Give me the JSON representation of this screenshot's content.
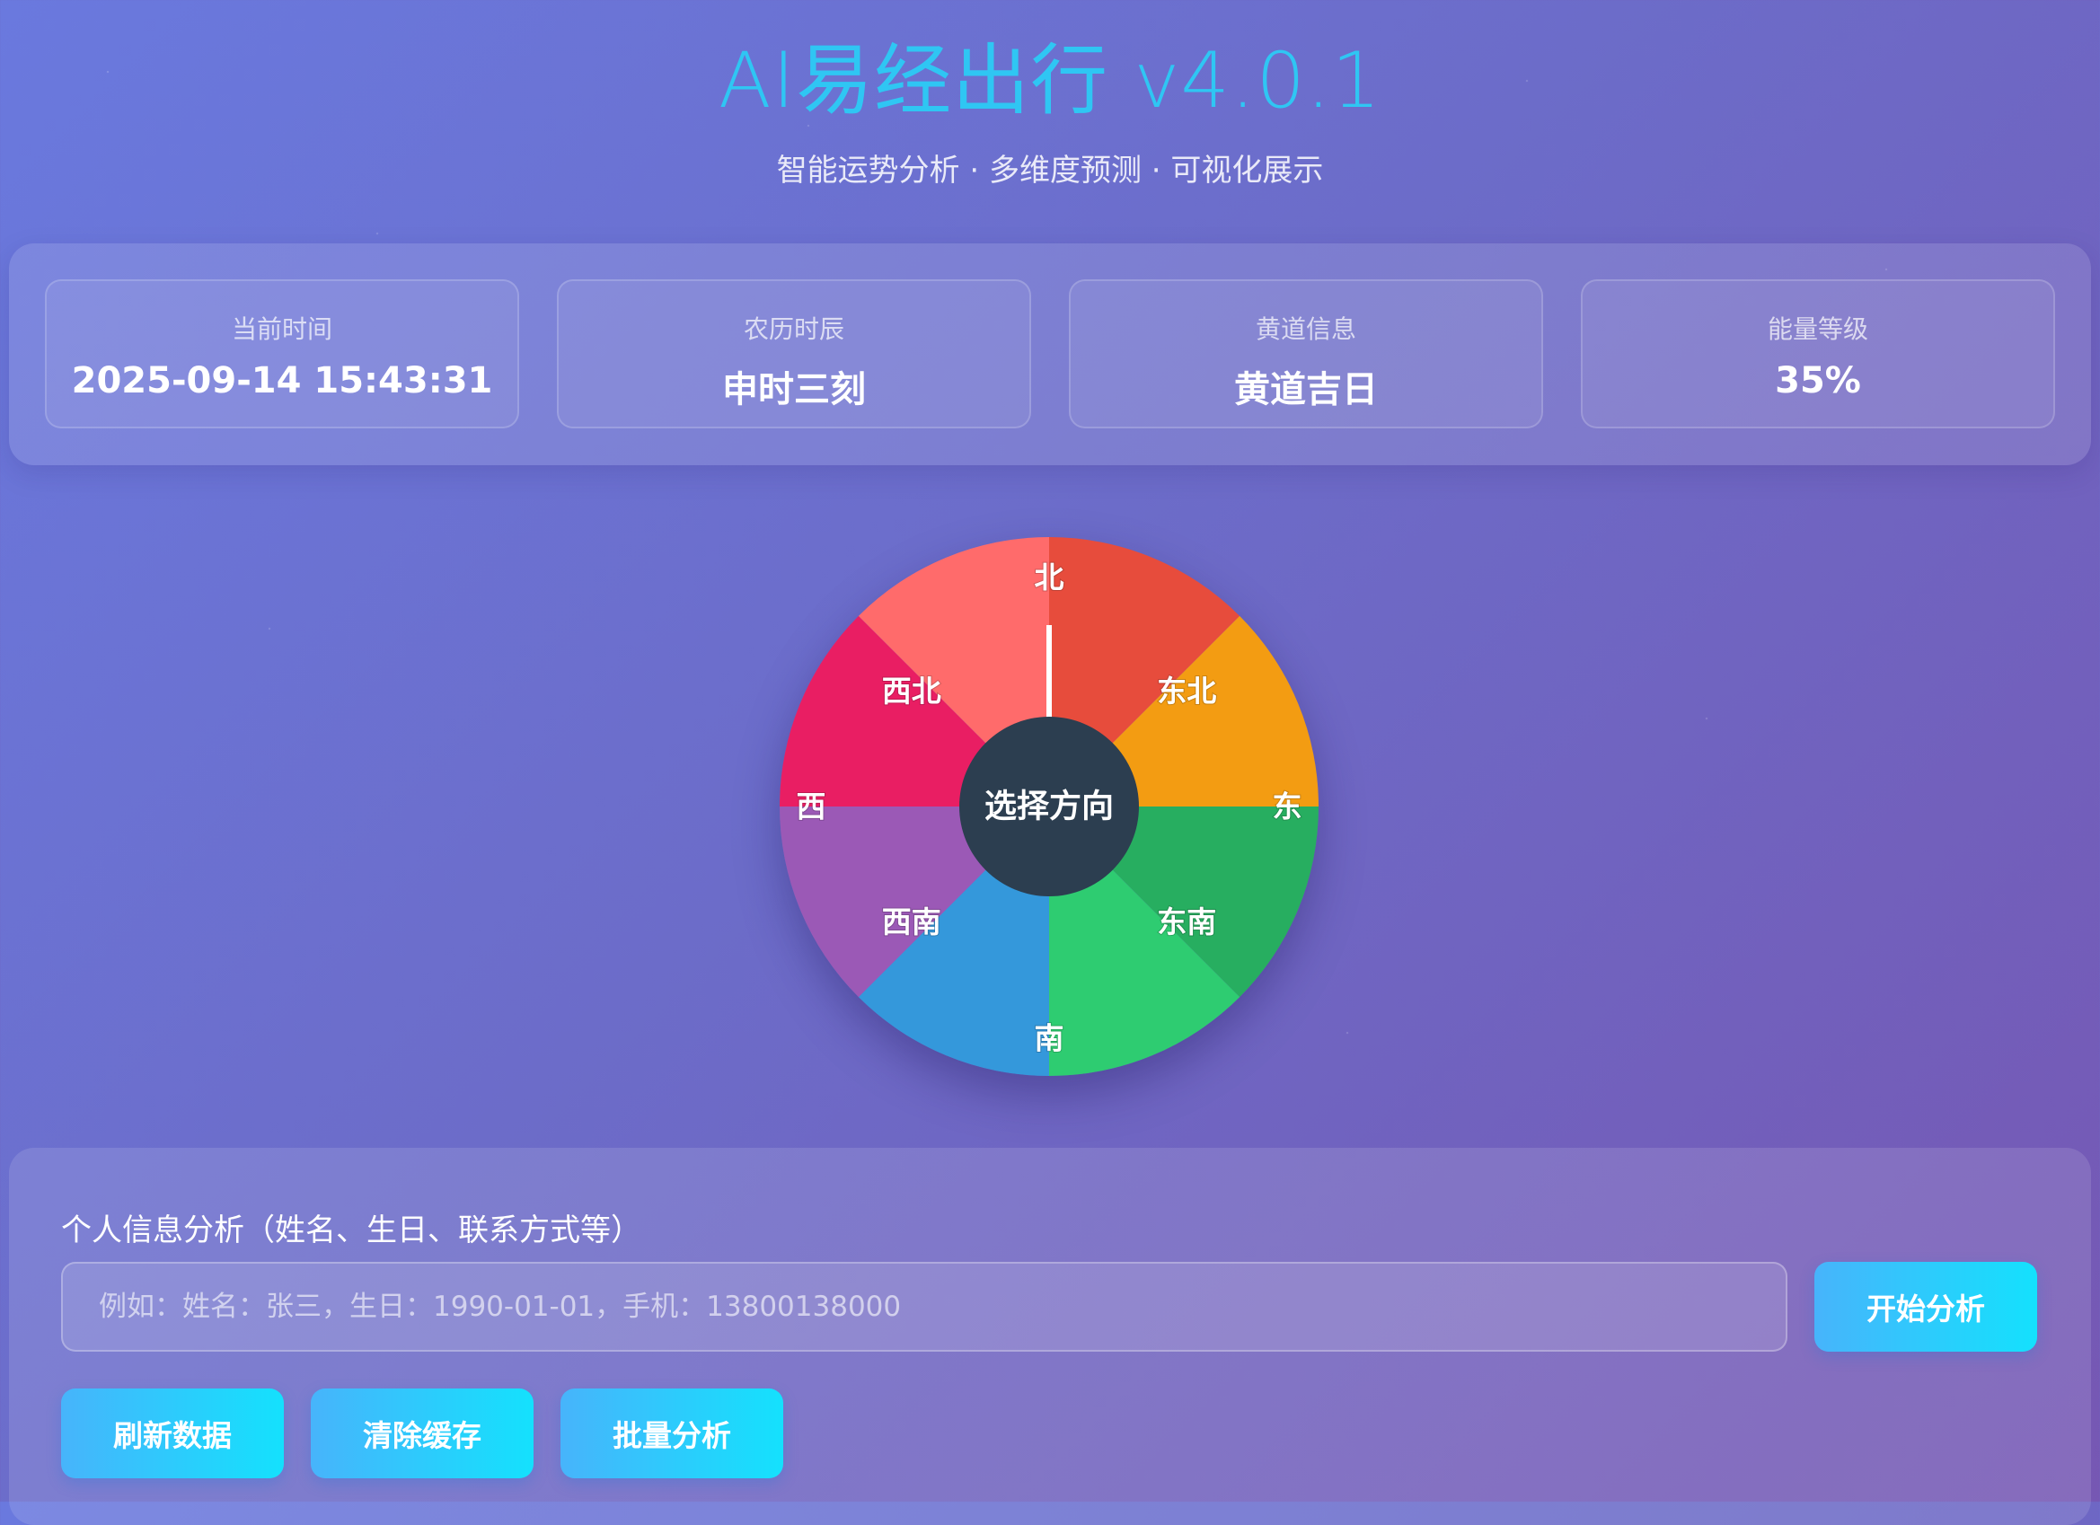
{
  "header": {
    "title": "AI易经出行 v4.0.1",
    "subtitle": "智能运势分析 · 多维度预测 · 可视化展示"
  },
  "info_cards": [
    {
      "label": "当前时间",
      "value": "2025-09-14 15:43:31"
    },
    {
      "label": "农历时辰",
      "value": "申时三刻"
    },
    {
      "label": "黄道信息",
      "value": "黄道吉日"
    },
    {
      "label": "能量等级",
      "value": "35%"
    }
  ],
  "wheel": {
    "center_label": "选择方向",
    "directions": [
      {
        "label": "北",
        "color": "#e74c3c"
      },
      {
        "label": "东北",
        "color": "#f39c12"
      },
      {
        "label": "东",
        "color": "#27ae60"
      },
      {
        "label": "东南",
        "color": "#2ecc71"
      },
      {
        "label": "南",
        "color": "#3498db"
      },
      {
        "label": "西南",
        "color": "#9b59b6"
      },
      {
        "label": "西",
        "color": "#e91e63"
      },
      {
        "label": "西北",
        "color": "#ff6b6b"
      }
    ],
    "center_color": "#2c3e50",
    "pointer_direction": "北"
  },
  "analysis": {
    "label": "个人信息分析（姓名、生日、联系方式等）",
    "placeholder": "例如：姓名：张三，生日：1990-01-01，手机：13800138000",
    "start_button": "开始分析",
    "actions": [
      "刷新数据",
      "清除缓存",
      "批量分析"
    ]
  },
  "colors": {
    "title": "#2fc6f3",
    "button_gradient_start": "#47b4fb",
    "button_gradient_end": "#14e1fd"
  }
}
